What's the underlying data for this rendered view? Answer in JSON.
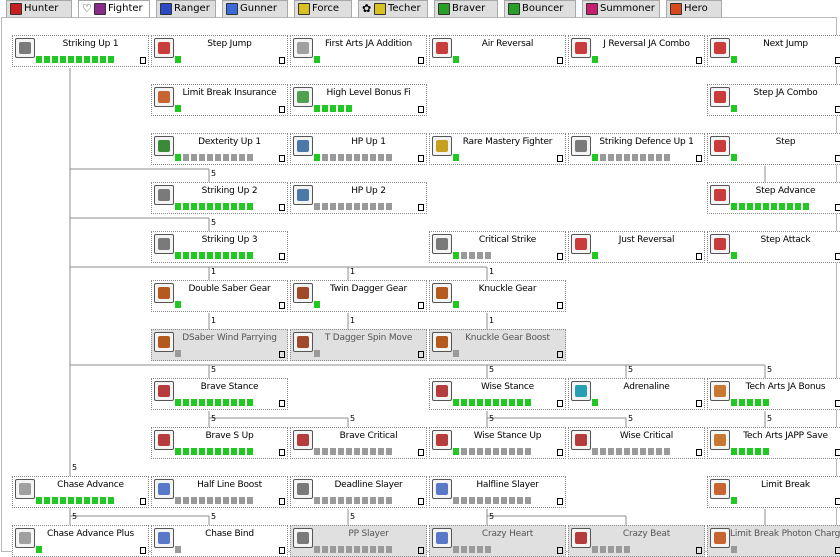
{
  "colors": {
    "pip_on": "#22c822",
    "pip_off": "#9a9a9a",
    "line": "#8c8c8c"
  },
  "tabs": [
    {
      "label": "Hunter",
      "icon_color": "#c81e1e",
      "icon": "hunter-icon"
    },
    {
      "label": "Fighter",
      "icon_color": "#8a2a8a",
      "icon": "fighter-icon",
      "prefix_glyph": "♡",
      "active": true
    },
    {
      "label": "Ranger",
      "icon_color": "#2a4ac8",
      "icon": "ranger-icon"
    },
    {
      "label": "Gunner",
      "icon_color": "#3a6ad8",
      "icon": "gunner-icon"
    },
    {
      "label": "Force",
      "icon_color": "#d8c020",
      "icon": "force-icon"
    },
    {
      "label": "Techer",
      "icon_color": "#d8c020",
      "icon": "techer-icon",
      "prefix_glyph": "✿"
    },
    {
      "label": "Braver",
      "icon_color": "#28a028",
      "icon": "braver-icon"
    },
    {
      "label": "Bouncer",
      "icon_color": "#28a028",
      "icon": "bouncer-icon"
    },
    {
      "label": "Summoner",
      "icon_color": "#c81e6e",
      "icon": "summoner-icon"
    },
    {
      "label": "Hero",
      "icon_color": "#d84a1e",
      "icon": "hero-icon"
    }
  ],
  "skills": [
    {
      "id": "striking-up-1",
      "name": "Striking Up 1",
      "level": 10,
      "max": 10,
      "icon": "sword-up-icon",
      "icon_color": "#7a7a7a"
    },
    {
      "id": "step-jump",
      "name": "Step Jump",
      "level": 1,
      "max": 1,
      "icon": "step-jump-icon",
      "icon_color": "#c83c3c"
    },
    {
      "id": "first-arts-ja-addition",
      "name": "First Arts JA Addition",
      "level": 1,
      "max": 1,
      "icon": "first-arts-icon",
      "icon_color": "#a0a0a0"
    },
    {
      "id": "air-reversal",
      "name": "Air Reversal",
      "level": 1,
      "max": 1,
      "icon": "air-reversal-icon",
      "icon_color": "#c83c3c"
    },
    {
      "id": "j-reversal-ja-combo",
      "name": "J Reversal JA Combo",
      "level": 1,
      "max": 1,
      "icon": "j-reversal-icon",
      "icon_color": "#c83c3c"
    },
    {
      "id": "next-jump",
      "name": "Next Jump",
      "level": 1,
      "max": 1,
      "icon": "next-jump-icon",
      "icon_color": "#c83c3c"
    },
    {
      "id": "limit-break-insurance",
      "name": "Limit Break Insurance",
      "level": 1,
      "max": 1,
      "icon": "limit-break-insurance-icon",
      "icon_color": "#c86432"
    },
    {
      "id": "high-level-bonus-fi",
      "name": "High Level Bonus Fi",
      "level": 5,
      "max": 5,
      "icon": "high-level-bonus-icon",
      "icon_color": "#50a050"
    },
    {
      "id": "step-ja-combo",
      "name": "Step JA Combo",
      "level": 1,
      "max": 1,
      "icon": "step-ja-combo-icon",
      "icon_color": "#c83c3c"
    },
    {
      "id": "dexterity-up-1",
      "name": "Dexterity Up 1",
      "level": 1,
      "max": 10,
      "icon": "dexterity-icon",
      "icon_color": "#3a8a3a"
    },
    {
      "id": "hp-up-1",
      "name": "HP Up 1",
      "level": 1,
      "max": 10,
      "icon": "hp-up-icon",
      "icon_color": "#4a78a8"
    },
    {
      "id": "rare-mastery-fighter",
      "name": "Rare Mastery Fighter",
      "level": 1,
      "max": 1,
      "icon": "rare-mastery-icon",
      "icon_color": "#c8a020"
    },
    {
      "id": "striking-defence-up-1",
      "name": "Striking Defence Up 1",
      "level": 1,
      "max": 10,
      "icon": "striking-defence-icon",
      "icon_color": "#7a7a7a"
    },
    {
      "id": "step",
      "name": "Step",
      "level": 1,
      "max": 1,
      "icon": "step-icon",
      "icon_color": "#c83c3c"
    },
    {
      "id": "striking-up-2",
      "name": "Striking Up 2",
      "level": 10,
      "max": 10,
      "icon": "sword-up-icon",
      "icon_color": "#7a7a7a"
    },
    {
      "id": "hp-up-2",
      "name": "HP Up 2",
      "level": 0,
      "max": 10,
      "icon": "hp-up-icon",
      "icon_color": "#4a78a8"
    },
    {
      "id": "step-advance",
      "name": "Step Advance",
      "level": 10,
      "max": 10,
      "icon": "step-advance-icon",
      "icon_color": "#c83c3c"
    },
    {
      "id": "striking-up-3",
      "name": "Striking Up 3",
      "level": 10,
      "max": 10,
      "icon": "sword-up-icon",
      "icon_color": "#7a7a7a"
    },
    {
      "id": "critical-strike",
      "name": "Critical Strike",
      "level": 1,
      "max": 5,
      "icon": "critical-strike-icon",
      "icon_color": "#7a7a7a"
    },
    {
      "id": "just-reversal",
      "name": "Just Reversal",
      "level": 1,
      "max": 1,
      "icon": "just-reversal-icon",
      "icon_color": "#c83c3c"
    },
    {
      "id": "step-attack",
      "name": "Step Attack",
      "level": 1,
      "max": 1,
      "icon": "step-attack-icon",
      "icon_color": "#c83c3c"
    },
    {
      "id": "double-saber-gear",
      "name": "Double Saber Gear",
      "level": 1,
      "max": 1,
      "icon": "double-saber-icon",
      "icon_color": "#b45a1e"
    },
    {
      "id": "twin-dagger-gear",
      "name": "Twin Dagger Gear",
      "level": 1,
      "max": 1,
      "icon": "twin-dagger-icon",
      "icon_color": "#a04a2a"
    },
    {
      "id": "knuckle-gear",
      "name": "Knuckle Gear",
      "level": 1,
      "max": 1,
      "icon": "knuckle-icon",
      "icon_color": "#b45a1e"
    },
    {
      "id": "dsaber-wind-parrying",
      "name": "DSaber Wind Parrying",
      "level": 0,
      "max": 1,
      "icon": "double-saber-icon",
      "icon_color": "#b45a1e",
      "locked": true
    },
    {
      "id": "t-dagger-spin-move",
      "name": "T Dagger Spin Move",
      "level": 0,
      "max": 1,
      "icon": "twin-dagger-icon",
      "icon_color": "#a04a2a",
      "locked": true
    },
    {
      "id": "knuckle-gear-boost",
      "name": "Knuckle Gear Boost",
      "level": 0,
      "max": 1,
      "icon": "knuckle-icon",
      "icon_color": "#b45a1e",
      "locked": true
    },
    {
      "id": "brave-stance",
      "name": "Brave Stance",
      "level": 10,
      "max": 10,
      "icon": "brave-stance-icon",
      "icon_color": "#b43c3c"
    },
    {
      "id": "wise-stance",
      "name": "Wise Stance",
      "level": 10,
      "max": 10,
      "icon": "wise-stance-icon",
      "icon_color": "#b43c3c"
    },
    {
      "id": "adrenaline",
      "name": "Adrenaline",
      "level": 1,
      "max": 1,
      "icon": "adrenaline-icon",
      "icon_color": "#28a0b4"
    },
    {
      "id": "tech-arts-ja-bonus",
      "name": "Tech Arts JA Bonus",
      "level": 5,
      "max": 5,
      "icon": "tech-arts-icon",
      "icon_color": "#c87832"
    },
    {
      "id": "brave-s-up",
      "name": "Brave S Up",
      "level": 10,
      "max": 10,
      "icon": "brave-s-up-icon",
      "icon_color": "#b43c3c"
    },
    {
      "id": "brave-critical",
      "name": "Brave Critical",
      "level": 0,
      "max": 10,
      "icon": "brave-critical-icon",
      "icon_color": "#b43c3c"
    },
    {
      "id": "wise-stance-up",
      "name": "Wise Stance Up",
      "level": 1,
      "max": 10,
      "icon": "wise-stance-up-icon",
      "icon_color": "#b43c3c"
    },
    {
      "id": "wise-critical",
      "name": "Wise Critical",
      "level": 0,
      "max": 10,
      "icon": "wise-critical-icon",
      "icon_color": "#b43c3c"
    },
    {
      "id": "tech-arts-japp-save",
      "name": "Tech Arts JAPP Save",
      "level": 5,
      "max": 5,
      "icon": "tech-arts-icon",
      "icon_color": "#c87832"
    },
    {
      "id": "chase-advance",
      "name": "Chase Advance",
      "level": 10,
      "max": 10,
      "icon": "chase-advance-icon",
      "icon_color": "#a0a0a0"
    },
    {
      "id": "half-line-boost",
      "name": "Half Line Boost",
      "level": 0,
      "max": 10,
      "icon": "half-line-boost-icon",
      "icon_color": "#5a78c8"
    },
    {
      "id": "deadline-slayer",
      "name": "Deadline Slayer",
      "level": 0,
      "max": 10,
      "icon": "deadline-slayer-icon",
      "icon_color": "#7a7a7a"
    },
    {
      "id": "halfline-slayer",
      "name": "Halfline Slayer",
      "level": 0,
      "max": 10,
      "icon": "halfline-slayer-icon",
      "icon_color": "#5a78c8"
    },
    {
      "id": "limit-break",
      "name": "Limit Break",
      "level": 1,
      "max": 1,
      "icon": "limit-break-icon",
      "icon_color": "#c86432"
    },
    {
      "id": "chase-advance-plus",
      "name": "Chase Advance Plus",
      "level": 1,
      "max": 1,
      "icon": "chase-advance-plus-icon",
      "icon_color": "#a0a0a0"
    },
    {
      "id": "chase-bind",
      "name": "Chase Bind",
      "level": 0,
      "max": 1,
      "icon": "chase-bind-icon",
      "icon_color": "#5a78c8"
    },
    {
      "id": "pp-slayer",
      "name": "PP Slayer",
      "level": 0,
      "max": 10,
      "icon": "pp-slayer-icon",
      "icon_color": "#7a7a7a",
      "locked": true
    },
    {
      "id": "crazy-heart",
      "name": "Crazy Heart",
      "level": 0,
      "max": 5,
      "icon": "crazy-heart-icon",
      "icon_color": "#5a78c8",
      "locked": true
    },
    {
      "id": "crazy-beat",
      "name": "Crazy Beat",
      "level": 0,
      "max": 5,
      "icon": "crazy-beat-icon",
      "icon_color": "#b43c3c",
      "locked": true
    },
    {
      "id": "limit-break-photon-charge",
      "name": "Limit Break Photon Charge",
      "level": 0,
      "max": 1,
      "icon": "limit-break-icon",
      "icon_color": "#c86432",
      "locked": true
    }
  ],
  "requirements": [
    {
      "label": "5"
    },
    {
      "label": "5"
    },
    {
      "label": "1"
    },
    {
      "label": "1"
    },
    {
      "label": "1"
    },
    {
      "label": "1"
    },
    {
      "label": "1"
    },
    {
      "label": "1"
    },
    {
      "label": "5"
    },
    {
      "label": "5"
    },
    {
      "label": "5"
    },
    {
      "label": "5"
    },
    {
      "label": "5"
    },
    {
      "label": "5"
    },
    {
      "label": "5"
    },
    {
      "label": "5"
    },
    {
      "label": "5"
    },
    {
      "label": "5"
    },
    {
      "label": "5"
    },
    {
      "label": "5"
    },
    {
      "label": "5"
    },
    {
      "label": "5"
    }
  ]
}
